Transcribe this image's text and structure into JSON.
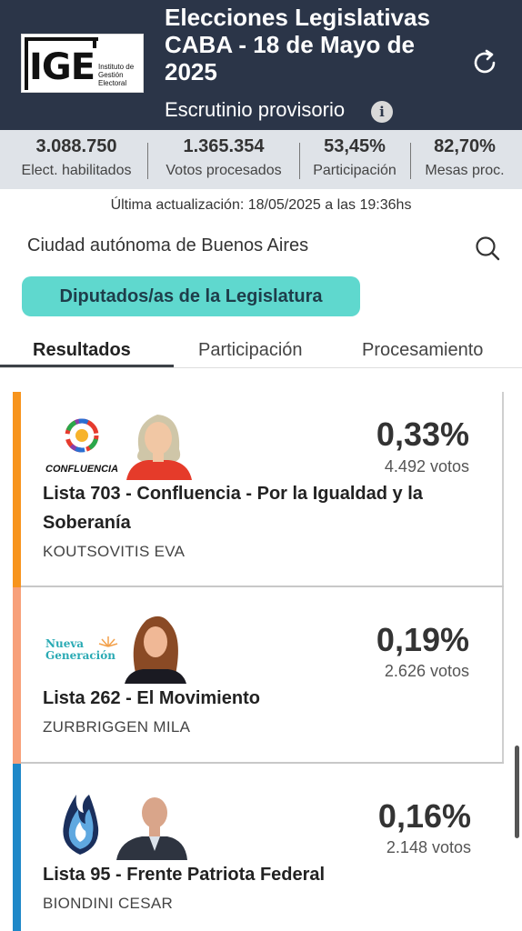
{
  "header": {
    "logo_letters": "IGE",
    "logo_subtext": "Instituto de Gestión Electoral",
    "title": "Elecciones Legislativas CABA - 18 de Mayo de 2025",
    "subtitle": "Escrutinio provisorio",
    "info_glyph": "i",
    "colors": {
      "background": "#2b3548"
    }
  },
  "stats": [
    {
      "value": "3.088.750",
      "label": "Elect. habilitados"
    },
    {
      "value": "1.365.354",
      "label": "Votos procesados"
    },
    {
      "value": "53,45%",
      "label": "Participación"
    },
    {
      "value": "82,70%",
      "label": "Mesas proc."
    }
  ],
  "updated": "Última actualización: 18/05/2025 a las 19:36hs",
  "region": "Ciudad autónoma de Buenos Aires",
  "category_chip": "Diputados/as de la Legislatura",
  "tabs": [
    "Resultados",
    "Participación",
    "Procesamiento"
  ],
  "active_tab": "Resultados",
  "results": [
    {
      "percent": "0,33%",
      "votes": "4.492 votos",
      "list": "Lista 703 - Confluencia - Por la Igualdad y la Soberanía",
      "candidate": "KOUTSOVITIS EVA",
      "logo_text": "CONFLUENCIA",
      "color": "#f7941d"
    },
    {
      "percent": "0,19%",
      "votes": "2.626 votos",
      "list": "Lista 262 - El Movimiento",
      "candidate": "ZURBRIGGEN MILA",
      "logo_text": "Nueva Generación",
      "color": "#f7a07a"
    },
    {
      "percent": "0,16%",
      "votes": "2.148 votos",
      "list": "Lista 95 - Frente Patriota Federal",
      "candidate": "BIONDINI CESAR",
      "logo_text": "",
      "color": "#1e88c8"
    }
  ],
  "icons": [
    "refresh-icon",
    "info-icon",
    "search-icon"
  ]
}
